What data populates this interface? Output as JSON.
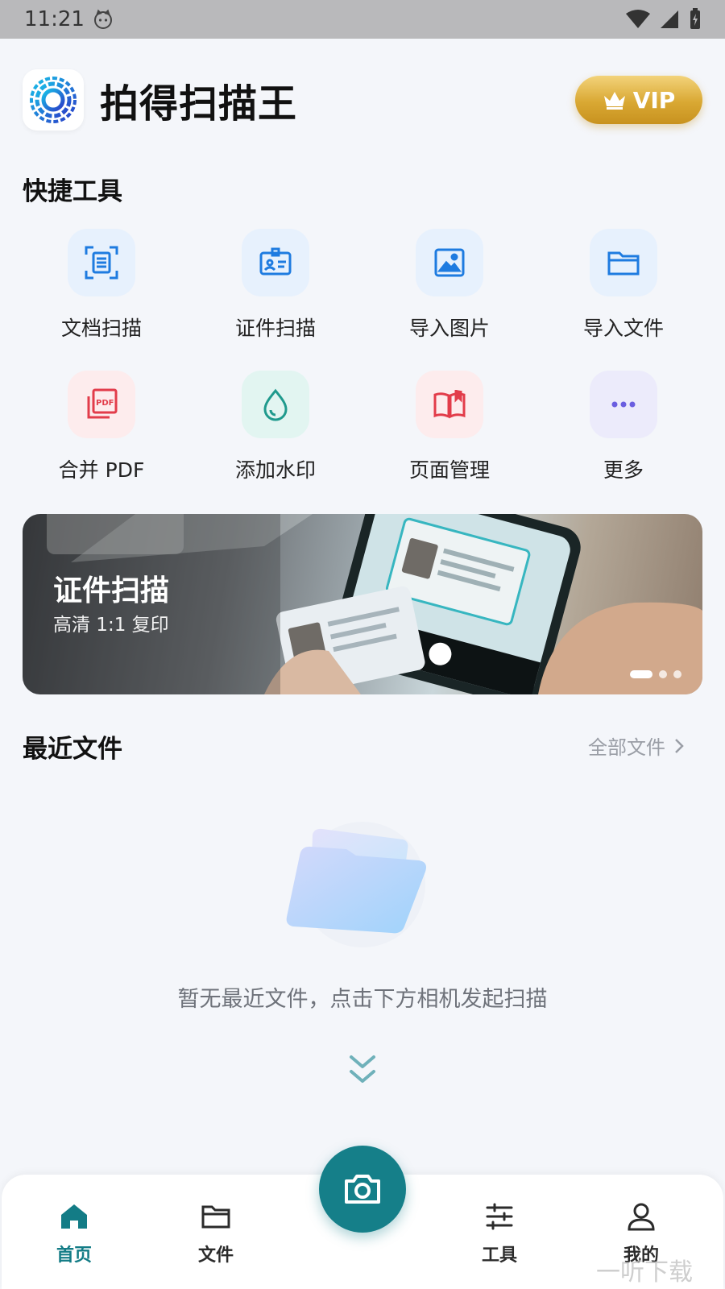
{
  "status_bar": {
    "time": "11:21"
  },
  "header": {
    "title": "拍得扫描王",
    "vip_label": "VIP"
  },
  "quick_tools": {
    "title": "快捷工具",
    "items": [
      {
        "label": "文档扫描",
        "icon": "document-scan-icon",
        "color": "#1e7be0",
        "bg": "#e7f1fd"
      },
      {
        "label": "证件扫描",
        "icon": "id-card-icon",
        "color": "#1e7be0",
        "bg": "#e7f1fd"
      },
      {
        "label": "导入图片",
        "icon": "image-icon",
        "color": "#1e7be0",
        "bg": "#e7f1fd"
      },
      {
        "label": "导入文件",
        "icon": "folder-icon",
        "color": "#1e7be0",
        "bg": "#e7f1fd"
      },
      {
        "label": "合并 PDF",
        "icon": "pdf-icon",
        "color": "#e23c4a",
        "bg": "#fdeced"
      },
      {
        "label": "添加水印",
        "icon": "water-drop-icon",
        "color": "#1f9a8d",
        "bg": "#e2f5f1"
      },
      {
        "label": "页面管理",
        "icon": "book-icon",
        "color": "#e23c4a",
        "bg": "#fdeced"
      },
      {
        "label": "更多",
        "icon": "more-icon",
        "color": "#6a5ee0",
        "bg": "#ecebfb"
      }
    ]
  },
  "banner": {
    "title": "证件扫描",
    "subtitle": "高清 1:1 复印"
  },
  "recent_files": {
    "title": "最近文件",
    "all_link": "全部文件",
    "empty_text": "暂无最近文件，点击下方相机发起扫描"
  },
  "bottom_nav": {
    "items": [
      {
        "label": "首页",
        "icon": "home-icon",
        "active": true
      },
      {
        "label": "文件",
        "icon": "folder-icon",
        "active": false
      },
      {
        "label": "工具",
        "icon": "sliders-icon",
        "active": false
      },
      {
        "label": "我的",
        "icon": "user-icon",
        "active": false
      }
    ]
  },
  "watermark": "一听下载",
  "colors": {
    "accent": "#157f89",
    "vip_gold": "#d9a833"
  }
}
